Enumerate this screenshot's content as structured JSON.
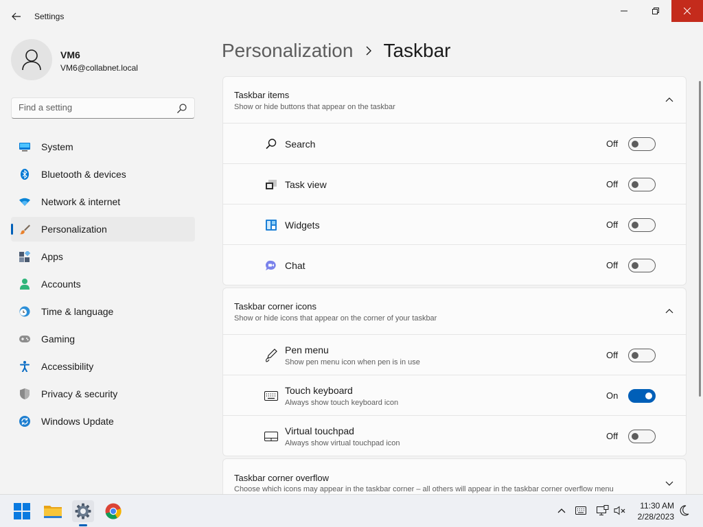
{
  "window": {
    "title": "Settings"
  },
  "user": {
    "name": "VM6",
    "email": "VM6@collabnet.local"
  },
  "search": {
    "placeholder": "Find a setting"
  },
  "sidebar": {
    "items": [
      {
        "label": "System",
        "icon": "system-icon"
      },
      {
        "label": "Bluetooth & devices",
        "icon": "bluetooth-icon"
      },
      {
        "label": "Network & internet",
        "icon": "wifi-icon"
      },
      {
        "label": "Personalization",
        "icon": "brush-icon",
        "active": true
      },
      {
        "label": "Apps",
        "icon": "apps-icon"
      },
      {
        "label": "Accounts",
        "icon": "account-icon"
      },
      {
        "label": "Time & language",
        "icon": "clock-globe-icon"
      },
      {
        "label": "Gaming",
        "icon": "gamepad-icon"
      },
      {
        "label": "Accessibility",
        "icon": "accessibility-icon"
      },
      {
        "label": "Privacy & security",
        "icon": "shield-icon"
      },
      {
        "label": "Windows Update",
        "icon": "update-icon"
      }
    ]
  },
  "breadcrumb": {
    "parent": "Personalization",
    "current": "Taskbar"
  },
  "taskbar_items": {
    "title": "Taskbar items",
    "subtitle": "Show or hide buttons that appear on the taskbar",
    "rows": [
      {
        "label": "Search",
        "state": "Off",
        "on": false,
        "icon": "search-icon"
      },
      {
        "label": "Task view",
        "state": "Off",
        "on": false,
        "icon": "task-view-icon"
      },
      {
        "label": "Widgets",
        "state": "Off",
        "on": false,
        "icon": "widgets-icon"
      },
      {
        "label": "Chat",
        "state": "Off",
        "on": false,
        "icon": "chat-icon"
      }
    ]
  },
  "corner_icons": {
    "title": "Taskbar corner icons",
    "subtitle": "Show or hide icons that appear on the corner of your taskbar",
    "rows": [
      {
        "label": "Pen menu",
        "desc": "Show pen menu icon when pen is in use",
        "state": "Off",
        "on": false,
        "icon": "pen-icon"
      },
      {
        "label": "Touch keyboard",
        "desc": "Always show touch keyboard icon",
        "state": "On",
        "on": true,
        "icon": "keyboard-icon"
      },
      {
        "label": "Virtual touchpad",
        "desc": "Always show virtual touchpad icon",
        "state": "Off",
        "on": false,
        "icon": "touchpad-icon"
      }
    ]
  },
  "corner_overflow": {
    "title": "Taskbar corner overflow",
    "subtitle": "Choose which icons may appear in the taskbar corner – all others will appear in the taskbar corner overflow menu"
  },
  "clock": {
    "time": "11:30 AM",
    "date": "2/28/2023"
  },
  "colors": {
    "accent": "#005fb8",
    "close_red": "#c42b1c",
    "background": "#f3f3f3",
    "card": "#fbfbfb"
  }
}
